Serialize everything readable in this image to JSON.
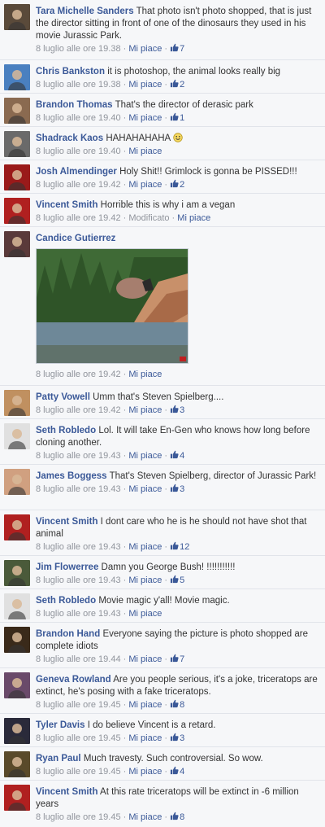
{
  "comments": [
    {
      "author": "Tara Michelle Sanders",
      "text": "That photo isn't photo shopped, that is just the director sitting in front of one of the dinosaurs they used in his movie Jurassic Park.",
      "time": "8 luglio alle ore 19.38",
      "edited": "",
      "like": "Mi piace",
      "likes": "7",
      "avatar": "#5a4a3a"
    },
    {
      "author": "Chris Bankston",
      "text": "it is photoshop, the animal looks really big",
      "time": "8 luglio alle ore 19.38",
      "edited": "",
      "like": "Mi piace",
      "likes": "2",
      "avatar": "#4a80c0"
    },
    {
      "author": "Brandon Thomas",
      "text": "That's the director of derasic park",
      "time": "8 luglio alle ore 19.40",
      "edited": "",
      "like": "Mi piace",
      "likes": "1",
      "avatar": "#8a6a50"
    },
    {
      "author": "Shadrack Kaos",
      "text": "HAHAHAHAHA",
      "time": "8 luglio alle ore 19.40",
      "edited": "",
      "like": "Mi piace",
      "likes": "",
      "avatar": "#6a6a6a",
      "emoji": "smiley-icon"
    },
    {
      "author": "Josh Almendinger",
      "text": "Holy Shit!! Grimlock is gonna be PISSED!!!",
      "time": "8 luglio alle ore 19.42",
      "edited": "",
      "like": "Mi piace",
      "likes": "2",
      "avatar": "#9a1a1a"
    },
    {
      "author": "Vincent Smith",
      "text": "Horrible this is why i am a vegan",
      "time": "8 luglio alle ore 19.42",
      "edited": "Modificato",
      "like": "Mi piace",
      "likes": "",
      "avatar": "#b02020"
    },
    {
      "author": "Candice Gutierrez",
      "text": "",
      "time": "8 luglio alle ore 19.42",
      "edited": "",
      "like": "Mi piace",
      "likes": "",
      "avatar": "#5a3a3a",
      "photo": "triceratops-lake-photo"
    },
    {
      "author": "Patty Vowell",
      "text": "Umm that's Steven Spielberg....",
      "time": "8 luglio alle ore 19.42",
      "edited": "",
      "like": "Mi piace",
      "likes": "3",
      "avatar": "#c09060"
    },
    {
      "author": "Seth Robledo",
      "text": "Lol. It will take En-Gen who knows how long before cloning another.",
      "time": "8 luglio alle ore 19.43",
      "edited": "",
      "like": "Mi piace",
      "likes": "4",
      "avatar": "#e0e0e0"
    },
    {
      "author": "James Boggess",
      "text": "That's Steven Spielberg, director of Jurassic Park!",
      "time": "8 luglio alle ore 19.43",
      "edited": "",
      "like": "Mi piace",
      "likes": "3",
      "avatar": "#d0a080"
    },
    {
      "author": "Vincent Smith",
      "text": "I dont care who he is he should not have shot that animal",
      "time": "8 luglio alle ore 19.43",
      "edited": "",
      "like": "Mi piace",
      "likes": "12",
      "avatar": "#b02020"
    },
    {
      "author": "Jim Flowerree",
      "text": "Damn you George Bush! !!!!!!!!!!!",
      "time": "8 luglio alle ore 19.43",
      "edited": "",
      "like": "Mi piace",
      "likes": "5",
      "avatar": "#4a5a3a"
    },
    {
      "author": "Seth Robledo",
      "text": "Movie magic y'all! Movie magic.",
      "time": "8 luglio alle ore 19.43",
      "edited": "",
      "like": "Mi piace",
      "likes": "",
      "avatar": "#e0e0e0"
    },
    {
      "author": "Brandon Hand",
      "text": "Everyone saying the picture is photo shopped are complete idiots",
      "time": "8 luglio alle ore 19.44",
      "edited": "",
      "like": "Mi piace",
      "likes": "7",
      "avatar": "#3a2a1a"
    },
    {
      "author": "Geneva Rowland",
      "text": "Are you people serious, it's a joke, triceratops are extinct, he's posing with a fake triceratops.",
      "time": "8 luglio alle ore 19.45",
      "edited": "",
      "like": "Mi piace",
      "likes": "8",
      "avatar": "#6a4a6a"
    },
    {
      "author": "Tyler Davis",
      "text": "I do believe Vincent is a retard.",
      "time": "8 luglio alle ore 19.45",
      "edited": "",
      "like": "Mi piace",
      "likes": "3",
      "avatar": "#2a2a3a"
    },
    {
      "author": "Ryan Paul",
      "text": "Much travesty. Such controversial. So wow.",
      "time": "8 luglio alle ore 19.45",
      "edited": "",
      "like": "Mi piace",
      "likes": "4",
      "avatar": "#5a4a2a"
    },
    {
      "author": "Vincent Smith",
      "text": "At this rate triceratops will be extinct in -6 million years",
      "time": "8 luglio alle ore 19.45",
      "edited": "",
      "like": "Mi piace",
      "likes": "8",
      "avatar": "#b02020"
    }
  ]
}
